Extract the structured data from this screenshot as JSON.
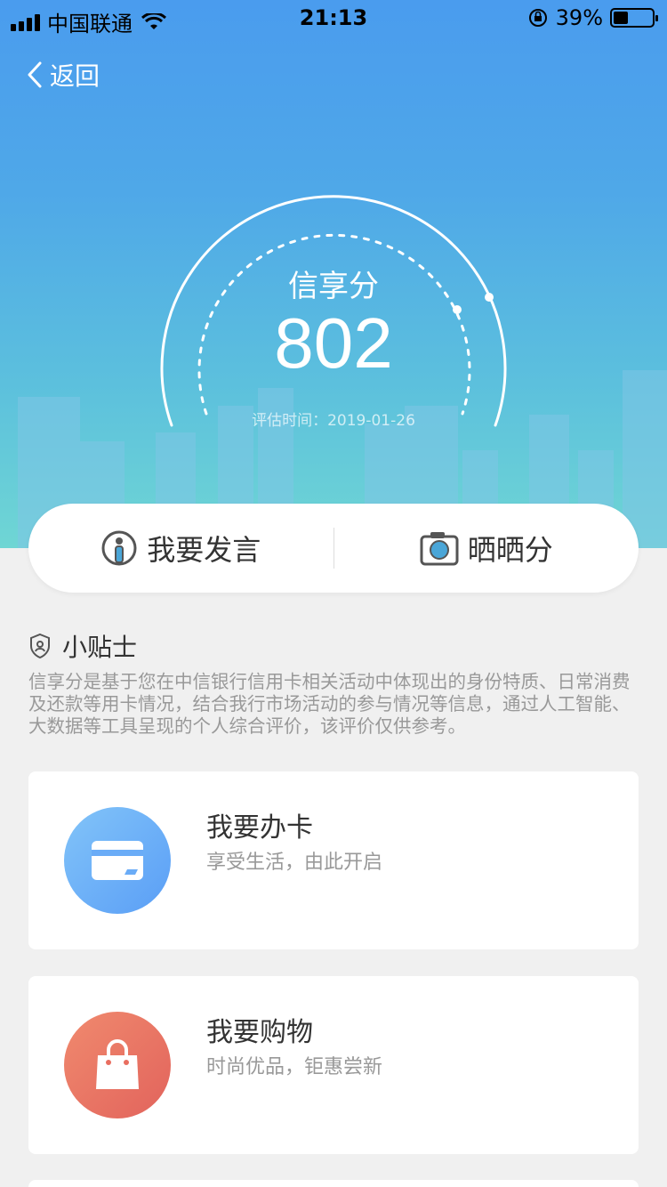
{
  "status_bar": {
    "carrier": "中国联通",
    "time": "21:13",
    "battery": "39%",
    "battery_level": 0.39
  },
  "nav": {
    "back_label": "返回"
  },
  "score": {
    "title": "信享分",
    "value": "802",
    "date_label": "评估时间：2019-01-26"
  },
  "actions": [
    {
      "label": "我要发言",
      "icon": "speaker-person-icon"
    },
    {
      "label": "晒晒分",
      "icon": "camera-icon"
    }
  ],
  "tips": {
    "title": "小贴士",
    "text": "信享分是基于您在中信银行信用卡相关活动中体现出的身份特质、日常消费及还款等用卡情况，结合我行市场活动的参与情况等信息，通过人工智能、大数据等工具呈现的个人综合评价，该评价仅供参考。"
  },
  "cards": [
    {
      "title": "我要办卡",
      "subtitle": "享受生活，由此开启",
      "icon": "credit-card-icon",
      "color_from": "#82c4f9",
      "color_to": "#5a9ef6"
    },
    {
      "title": "我要购物",
      "subtitle": "时尚优品，钜惠尝新",
      "icon": "shopping-bag-icon",
      "color_from": "#f08a6e",
      "color_to": "#e2635c"
    }
  ]
}
